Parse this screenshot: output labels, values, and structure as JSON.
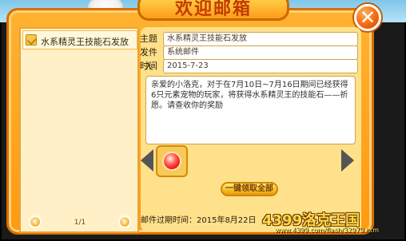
{
  "header": {
    "title": "欢迎邮箱"
  },
  "close_button": {
    "label": "✕"
  },
  "mail_list": {
    "items": [
      {
        "label": "水系精灵王技能石发放",
        "selected": true
      }
    ],
    "pager": {
      "text": "1/1"
    }
  },
  "mail_detail": {
    "subject_label": "主题",
    "subject_value": "水系精灵王技能石发放",
    "sender_label": "发件人",
    "sender_value": "系统邮件",
    "time_label": "时间",
    "time_value": "2015-7-23",
    "content": "亲爱的小洛克，对于在7月10日~7月16日期间已经获得6只元素宠物的玩家，将获得水系精灵王的技能石——祈愿。请查收你的奖励",
    "claim_button": "一键领取全部",
    "expiry_text": "邮件过期时间：2015年8月22日"
  },
  "watermark": {
    "main": "4399洛克王国",
    "sub": "www.4399.com/flash/32979.htm"
  }
}
